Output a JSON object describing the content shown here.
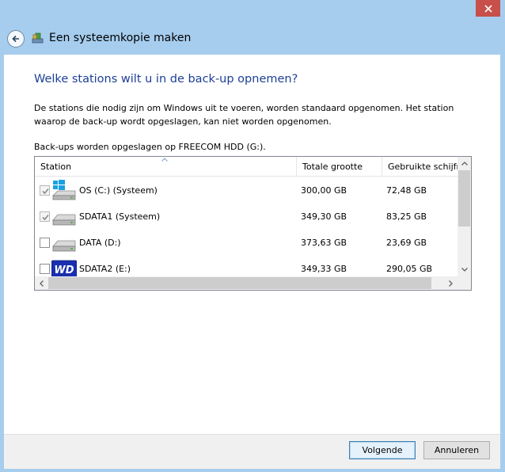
{
  "window": {
    "title": "Een systeemkopie maken",
    "icons": {
      "close": "close-icon",
      "back": "back-arrow-icon",
      "app": "backup-app-icon"
    }
  },
  "page": {
    "heading": "Welke stations wilt u in de back-up opnemen?",
    "description": "De stations die nodig zijn om Windows uit te voeren, worden standaard opgenomen. Het station waarop de back-up wordt opgeslagen, kan niet worden opgenomen.",
    "backup_destination": "Back-ups worden opgeslagen op FREECOM HDD (G:)."
  },
  "table": {
    "columns": [
      "Station",
      "Totale grootte",
      "Gebruikte schijfr..."
    ],
    "sorted_column": "Station",
    "rows": [
      {
        "name": "OS (C:) (Systeem)",
        "total": "300,00 GB",
        "used": "72,48 GB",
        "checked": true,
        "disabled": true,
        "icon": "windows-drive-icon"
      },
      {
        "name": "SDATA1 (Systeem)",
        "total": "349,30 GB",
        "used": "83,25 GB",
        "checked": true,
        "disabled": true,
        "icon": "hard-drive-icon"
      },
      {
        "name": "DATA (D:)",
        "total": "373,63 GB",
        "used": "23,69 GB",
        "checked": false,
        "disabled": false,
        "icon": "hard-drive-icon"
      },
      {
        "name": "SDATA2 (E:)",
        "total": "349,33 GB",
        "used": "290,05 GB",
        "checked": false,
        "disabled": false,
        "icon": "wd-drive-icon",
        "icon_text": "WD"
      }
    ]
  },
  "buttons": {
    "next": "Volgende",
    "cancel": "Annuleren"
  },
  "colors": {
    "frame": "#a6cdee",
    "heading": "#1c3f95",
    "close": "#c7504b",
    "wd_blue": "#1a2fb0"
  }
}
